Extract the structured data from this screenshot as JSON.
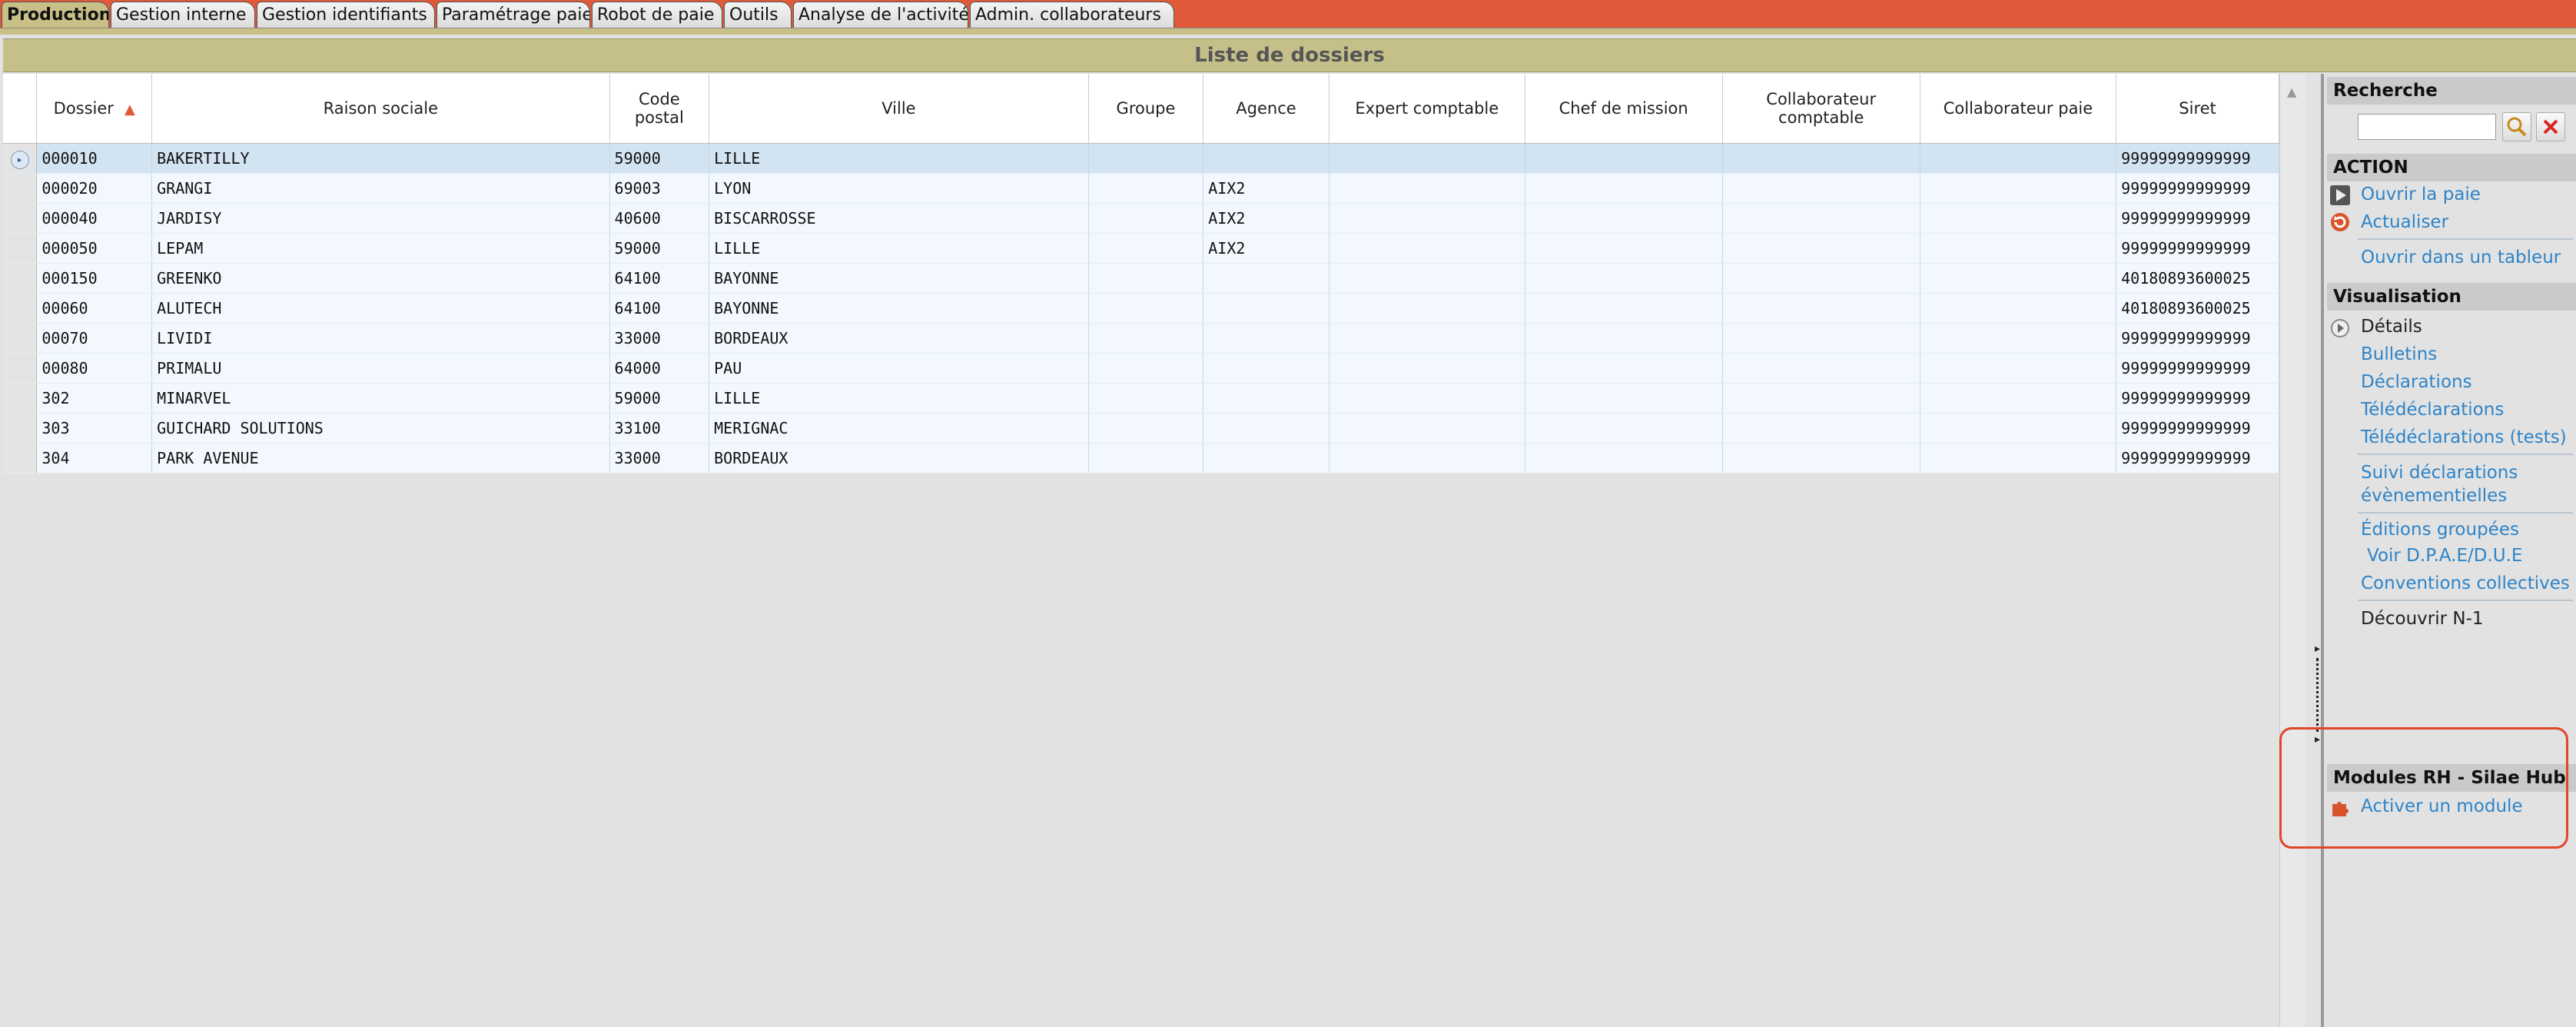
{
  "tabs": [
    "Production",
    "Gestion interne",
    "Gestion identifiants",
    "Paramétrage paie",
    "Robot de paie",
    "Outils",
    "Analyse de l'activité",
    "Admin. collaborateurs"
  ],
  "title": "Liste de dossiers",
  "columns": {
    "dossier": "Dossier",
    "raison": "Raison sociale",
    "code_postal_1": "Code",
    "code_postal_2": "postal",
    "ville": "Ville",
    "groupe": "Groupe",
    "agence": "Agence",
    "expert": "Expert comptable",
    "chef": "Chef de mission",
    "collab_compta": "Collaborateur comptable",
    "collab_paie": "Collaborateur paie",
    "siret": "Siret"
  },
  "sort_indicator": "▲",
  "rows": [
    {
      "dossier": "000010",
      "raison": "BAKERTILLY",
      "cp": "59000",
      "ville": "LILLE",
      "groupe": "",
      "agence": "",
      "siret": "99999999999999"
    },
    {
      "dossier": "000020",
      "raison": "GRANGI",
      "cp": "69003",
      "ville": "LYON",
      "groupe": "",
      "agence": "AIX2",
      "siret": "99999999999999"
    },
    {
      "dossier": "000040",
      "raison": "JARDISY",
      "cp": "40600",
      "ville": "BISCARROSSE",
      "groupe": "",
      "agence": "AIX2",
      "siret": "99999999999999"
    },
    {
      "dossier": "000050",
      "raison": "LEPAM",
      "cp": "59000",
      "ville": "LILLE",
      "groupe": "",
      "agence": "AIX2",
      "siret": "99999999999999"
    },
    {
      "dossier": "000150",
      "raison": "GREENKO",
      "cp": "64100",
      "ville": "BAYONNE",
      "groupe": "",
      "agence": "",
      "siret": "40180893600025"
    },
    {
      "dossier": "00060",
      "raison": "ALUTECH",
      "cp": "64100",
      "ville": "BAYONNE",
      "groupe": "",
      "agence": "",
      "siret": "40180893600025"
    },
    {
      "dossier": "00070",
      "raison": "LIVIDI",
      "cp": "33000",
      "ville": "BORDEAUX",
      "groupe": "",
      "agence": "",
      "siret": "99999999999999"
    },
    {
      "dossier": "00080",
      "raison": "PRIMALU",
      "cp": "64000",
      "ville": "PAU",
      "groupe": "",
      "agence": "",
      "siret": "99999999999999"
    },
    {
      "dossier": "302",
      "raison": "MINARVEL",
      "cp": "59000",
      "ville": "LILLE",
      "groupe": "",
      "agence": "",
      "siret": "99999999999999"
    },
    {
      "dossier": "303",
      "raison": "GUICHARD SOLUTIONS",
      "cp": "33100",
      "ville": "MERIGNAC",
      "groupe": "",
      "agence": "",
      "siret": "99999999999999"
    },
    {
      "dossier": "304",
      "raison": "PARK AVENUE",
      "cp": "33000",
      "ville": "BORDEAUX",
      "groupe": "",
      "agence": "",
      "siret": "99999999999999"
    }
  ],
  "panel": {
    "search_header": "Recherche",
    "action_header": "ACTION",
    "ouvrir_paie": "Ouvrir la paie",
    "actualiser": "Actualiser",
    "ouvrir_tableur": "Ouvrir dans un tableur",
    "visualisation_header": "Visualisation",
    "details": "Détails",
    "bulletins": "Bulletins",
    "declarations": "Déclarations",
    "teledeclarations": "Télédéclarations",
    "teledeclarations_tests": "Télédéclarations (tests)",
    "suivi_1": "Suivi déclarations",
    "suivi_2": "évènementielles",
    "editions": "Éditions groupées",
    "voir_dpae": "Voir D.P.A.E/D.U.E",
    "conventions": "Conventions collectives",
    "decouvrir": "Découvrir N-1",
    "modules_header": "Modules RH - Silae Hub",
    "activer_module": "Activer un module"
  },
  "colors": {
    "tabbar": "#e05a3a",
    "header": "#c5c08a",
    "link": "#2e84c8",
    "highlight": "#e0462a"
  }
}
